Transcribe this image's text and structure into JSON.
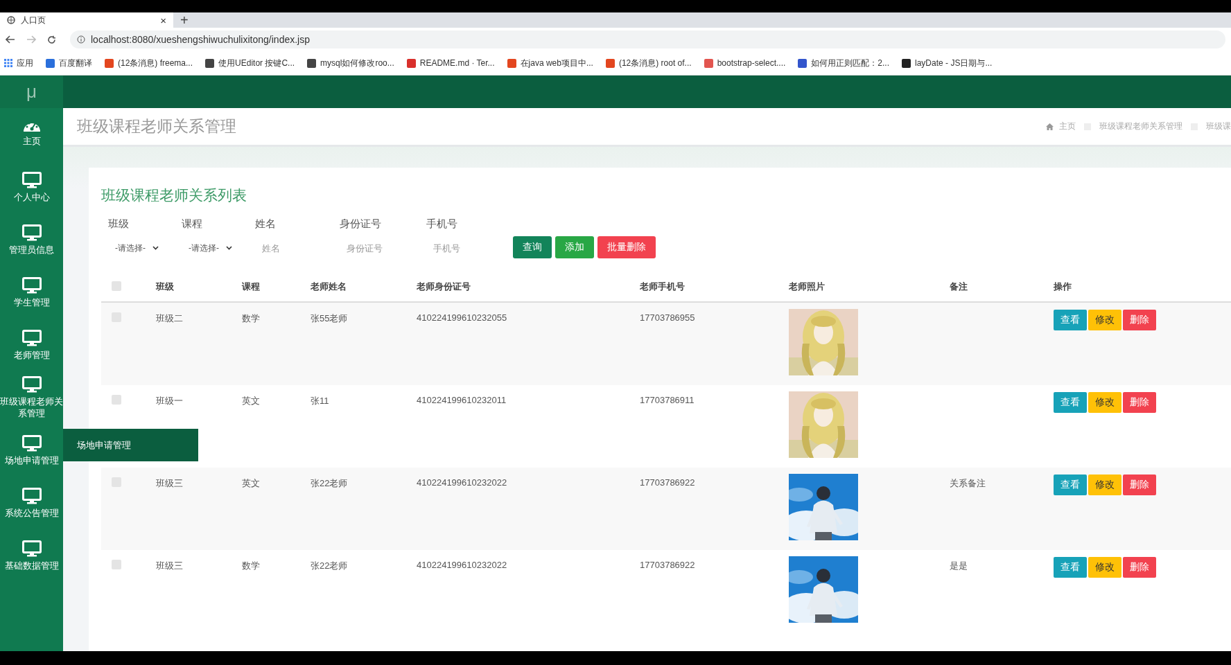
{
  "browser": {
    "tab": {
      "title": "人口页",
      "close": "×"
    },
    "new_tab": "+",
    "url": "localhost:8080/xueshengshiwuchulixitong/index.jsp",
    "bookmarks": [
      {
        "label": "应用",
        "color": "#4285f4"
      },
      {
        "label": "百度翻译",
        "color": "#2a6fdb"
      },
      {
        "label": "(12条消息) freema...",
        "color": "#e3461f"
      },
      {
        "label": "使用UEditor 按键C...",
        "color": "#444444"
      },
      {
        "label": "mysql如何修改roo...",
        "color": "#444444"
      },
      {
        "label": "README.md · Ter...",
        "color": "#d9302c"
      },
      {
        "label": "在java web项目中...",
        "color": "#e3461f"
      },
      {
        "label": "(12条消息) root of...",
        "color": "#e3461f"
      },
      {
        "label": "bootstrap-select....",
        "color": "#e2554f"
      },
      {
        "label": "如何用正则匹配：2...",
        "color": "#3355cc"
      },
      {
        "label": "layDate - JS日期与...",
        "color": "#222222"
      }
    ]
  },
  "app": {
    "logo": "μ",
    "sidebar": {
      "items": [
        {
          "label": "主页",
          "kind": "dashboard"
        },
        {
          "label": "个人中心",
          "kind": "monitor"
        },
        {
          "label": "管理员信息",
          "kind": "monitor"
        },
        {
          "label": "学生管理",
          "kind": "monitor"
        },
        {
          "label": "老师管理",
          "kind": "monitor"
        },
        {
          "label": "班级课程老师关系管理",
          "kind": "monitor"
        },
        {
          "label": "场地申请管理",
          "kind": "monitor",
          "flyout": "场地申请管理"
        },
        {
          "label": "系统公告管理",
          "kind": "monitor"
        },
        {
          "label": "基础数据管理",
          "kind": "monitor"
        }
      ]
    },
    "page_title": "班级课程老师关系管理",
    "breadcrumb": [
      "主页",
      "班级课程老师关系管理",
      "班级课"
    ],
    "card_title": "班级课程老师关系列表",
    "filters": [
      {
        "label": "班级",
        "kind": "select",
        "value": "-请选择-"
      },
      {
        "label": "课程",
        "kind": "select",
        "value": "-请选择-"
      },
      {
        "label": "姓名",
        "kind": "input",
        "placeholder": "姓名"
      },
      {
        "label": "身份证号",
        "kind": "input",
        "placeholder": "身份证号"
      },
      {
        "label": "手机号",
        "kind": "input",
        "placeholder": "手机号"
      }
    ],
    "actions": [
      {
        "label": "查询",
        "kind": "search"
      },
      {
        "label": "添加",
        "kind": "add"
      },
      {
        "label": "批量删除",
        "kind": "delete"
      }
    ],
    "table": {
      "all_selected": false,
      "columns": [
        "班级",
        "课程",
        "老师姓名",
        "老师身份证号",
        "老师手机号",
        "老师照片",
        "备注",
        "操作"
      ],
      "rows": [
        {
          "selected": false,
          "cells": [
            "班级二",
            "数学",
            "张55老师",
            "410224199610232055",
            "17703786955"
          ],
          "photo": {
            "kind": "picture"
          },
          "note": "",
          "buttons": [
            {
              "label": "查看",
              "kind": "view"
            },
            {
              "label": "修改",
              "kind": "edit"
            },
            {
              "label": "删除",
              "kind": "delete"
            }
          ]
        },
        {
          "selected": false,
          "cells": [
            "班级一",
            "英文",
            "张11",
            "410224199610232011",
            "17703786911"
          ],
          "photo": {
            "kind": "picture"
          },
          "note": "",
          "buttons": [
            {
              "label": "查看",
              "kind": "view"
            },
            {
              "label": "修改",
              "kind": "edit"
            },
            {
              "label": "删除",
              "kind": "delete"
            }
          ]
        },
        {
          "selected": false,
          "cells": [
            "班级三",
            "英文",
            "张22老师",
            "410224199610232022",
            "17703786922"
          ],
          "photo": {
            "kind": "picture"
          },
          "note": "关系备注",
          "buttons": [
            {
              "label": "查看",
              "kind": "view"
            },
            {
              "label": "修改",
              "kind": "edit"
            },
            {
              "label": "删除",
              "kind": "delete"
            }
          ]
        },
        {
          "selected": false,
          "cells": [
            "班级三",
            "数学",
            "张22老师",
            "410224199610232022",
            "17703786922"
          ],
          "photo": {
            "kind": "picture"
          },
          "note": "是是",
          "buttons": [
            {
              "label": "查看",
              "kind": "view"
            },
            {
              "label": "修改",
              "kind": "edit"
            },
            {
              "label": "删除",
              "kind": "delete"
            }
          ]
        }
      ]
    }
  }
}
